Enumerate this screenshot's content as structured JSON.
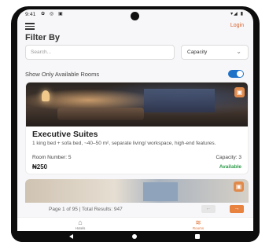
{
  "status_bar": {
    "time": "9:41",
    "icons_left": "✿ ◎ ▣",
    "icons_right": "▾◢ ▮"
  },
  "header": {
    "menu_icon": "hamburger-menu-icon",
    "login_label": "Login"
  },
  "filter": {
    "title": "Filter By",
    "search_placeholder": "Search...",
    "capacity_label": "Capacity",
    "show_available_label": "Show Only Available Rooms",
    "show_available_on": true
  },
  "rooms": [
    {
      "title": "Executive Suites",
      "description": "1 king bed + sofa bed, ~40–50 m², separate living/ workspace, high-end features.",
      "room_number_label": "Room Number: 5",
      "capacity_label": "Capacity: 3",
      "price": "₦250",
      "status": "Available"
    }
  ],
  "pagination": {
    "info": "Page 1 of 95 | Total Results: 947",
    "prev_label": "←",
    "next_label": "→"
  },
  "bottom_nav": {
    "hotels_label": "Hotels",
    "rooms_label": "Rooms"
  },
  "colors": {
    "accent": "#e0763a",
    "toggle": "#1e73c8",
    "available": "#2e9b4b"
  }
}
